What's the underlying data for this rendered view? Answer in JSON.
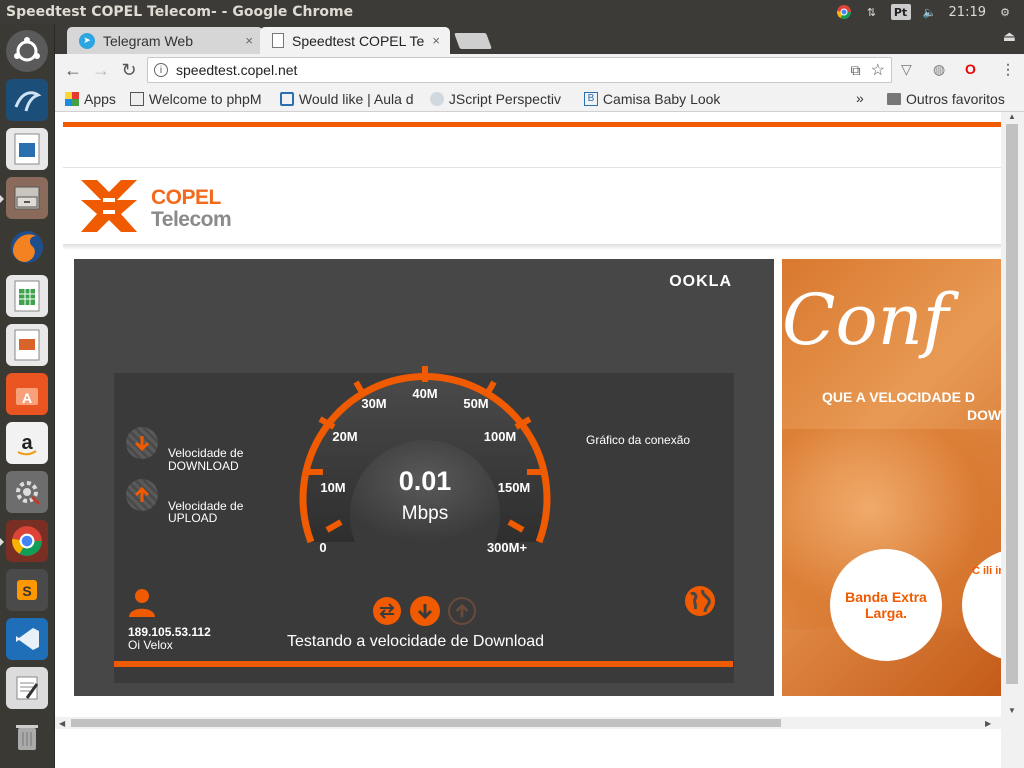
{
  "window": {
    "title": "Speedtest COPEL Telecom- - Google Chrome"
  },
  "indicators": {
    "lang": "Pt",
    "time": "21:19"
  },
  "tabs": [
    {
      "label": "Telegram Web",
      "close": "×"
    },
    {
      "label": "Speedtest COPEL Te",
      "close": "×"
    }
  ],
  "omnibox": {
    "url": "speedtest.copel.net"
  },
  "bookmarks": {
    "items": [
      {
        "label": "Apps"
      },
      {
        "label": "Welcome to phpM"
      },
      {
        "label": "Would like | Aula d"
      },
      {
        "label": "JScript Perspectiv"
      },
      {
        "label": "Camisa Baby Look"
      }
    ],
    "more": "»",
    "others": "Outros favoritos"
  },
  "logo": {
    "line1": "COPEL",
    "line2": "Telecom"
  },
  "speedtest": {
    "brand": "OOKLA",
    "download_label_1": "Velocidade de",
    "download_label_2": "DOWNLOAD",
    "upload_label_1": "Velocidade de",
    "upload_label_2": "UPLOAD",
    "graph_label": "Gráfico da conexão",
    "ip": "189.105.53.112",
    "isp": "Oi Velox",
    "speed_value": "0.01",
    "speed_unit": "Mbps",
    "status": "Testando a velocidade de Download",
    "gauge_ticks": [
      "0",
      "10M",
      "20M",
      "30M",
      "40M",
      "50M",
      "100M",
      "150M",
      "300M+"
    ],
    "progress": 1.0
  },
  "ad": {
    "script": "Conf",
    "line1": "QUE A VELOCIDADE D",
    "line2": "DOW",
    "bubble1": "Banda Extra Larga.",
    "bubble2": "C ili int filtro ou"
  },
  "colors": {
    "accent": "#f05a00",
    "stage": "#474747",
    "panel": "#3a3a3a"
  }
}
